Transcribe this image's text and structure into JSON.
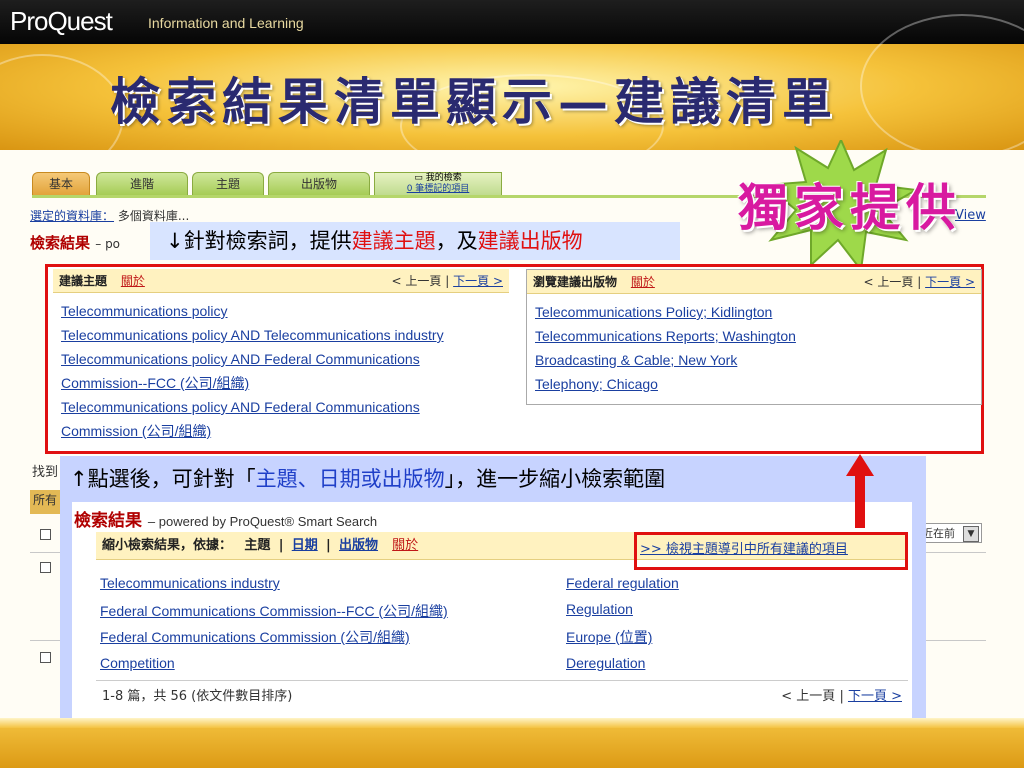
{
  "header": {
    "brand": "ProQuest",
    "tagline": "Information and Learning",
    "slide_title": "檢索結果清單顯示—建議清單"
  },
  "exclusive_badge": "獨家提供",
  "tabs": [
    {
      "label": "基本"
    },
    {
      "label": "進階"
    },
    {
      "label": "主題"
    },
    {
      "label": "出版物"
    }
  ],
  "my_search": {
    "line1": "我的檢索",
    "line2": "0 筆標記的項目"
  },
  "db_row": {
    "label": "選定的資料庫：",
    "value": "多個資料庫..."
  },
  "view_link": "View",
  "results": {
    "title": "檢索結果",
    "powered_short": "– po"
  },
  "callout1": {
    "prefix": "↓針對檢索詞，提供",
    "s1": "建議主題",
    "mid": "，及",
    "s2": "建議出版物"
  },
  "suggested_topics": {
    "title": "建議主題",
    "about": "關於",
    "prev": "< 上一頁",
    "sep": "|",
    "next": "下一頁 >",
    "items": [
      "Telecommunications policy",
      "Telecommunications policy AND Telecommunications industry",
      "Telecommunications policy AND Federal Communications",
      "Commission--FCC (公司/組織)",
      "Telecommunications policy AND Federal Communications",
      "Commission (公司/組織)"
    ]
  },
  "suggested_pubs": {
    "title": "瀏覽建議出版物",
    "about": "關於",
    "prev": "< 上一頁",
    "sep": "|",
    "next": "下一頁 >",
    "items": [
      "Telecommunications Policy; Kidlington",
      "Telecommunications Reports; Washington",
      "Broadcasting & Cable; New York",
      "Telephony; Chicago"
    ]
  },
  "under": {
    "found_label": "找到",
    "all_tab": "所有",
    "sort_value": "最近在前"
  },
  "callout2": {
    "prefix": "↑點選後，可針對「",
    "highlight": "主題、日期或出版物",
    "suffix": "」，進一步縮小檢索範圍"
  },
  "inner": {
    "title": "檢索結果",
    "powered": "– powered by ProQuest® Smart Search",
    "narrow_label": "縮小檢索結果，依據：",
    "narrow_topic": "主題",
    "narrow_sep": "|",
    "narrow_date": "日期",
    "narrow_pub": "出版物",
    "about": "關於",
    "view_all": ">> 檢視主題導引中所有建議的項目",
    "left_links": [
      "Telecommunications industry",
      "Federal Communications Commission--FCC (公司/組織)",
      "Federal Communications Commission (公司/組織)",
      "Competition"
    ],
    "right_links": [
      "Federal regulation",
      "Regulation",
      "Europe (位置)",
      "Deregulation"
    ],
    "footer_count": "1-8 篇，共 56 (依文件數目排序)",
    "prev": "< 上一頁",
    "sep": "|",
    "next": "下一頁 >"
  },
  "colors": {
    "accent_red": "#e01010",
    "link_blue": "#1a3fa0",
    "callout_bg": "#c7d3ff",
    "exclusive": "#d81aa0"
  }
}
